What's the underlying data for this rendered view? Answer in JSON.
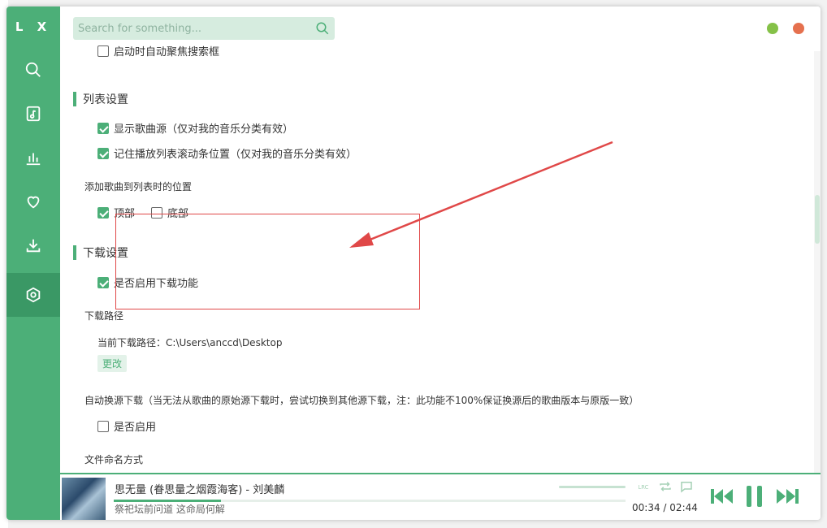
{
  "app": {
    "logo": "L X"
  },
  "search": {
    "placeholder": "Search for something..."
  },
  "window_buttons": {
    "min_color": "#85c148",
    "close_color": "#e5704e"
  },
  "settings": {
    "partial_item": "启动时自动聚焦搜索框",
    "list_section": {
      "title": "列表设置",
      "show_source": "显示歌曲源（仅对我的音乐分类有效）",
      "remember_scroll": "记住播放列表滚动条位置（仅对我的音乐分类有效）",
      "add_position_label": "添加歌曲到列表时的位置",
      "top": "顶部",
      "bottom": "底部"
    },
    "download_section": {
      "title": "下载设置",
      "enable": "是否启用下载功能",
      "path_label": "下载路径",
      "current_path_prefix": "当前下载路径：",
      "current_path": "C:\\Users\\anccd\\Desktop",
      "change_button": "更改",
      "auto_switch_label": "自动换源下载（当无法从歌曲的原始源下载时，尝试切换到其他源下载，注：此功能不100%保证换源后的歌曲版本与原版一致）",
      "auto_switch_enable": "是否启用",
      "file_naming_label": "文件命名方式"
    }
  },
  "player": {
    "title": "思无量 (眷思量之烟霞海客) - 刘美麟",
    "lyric": "祭祀坛前问道 这命局何解",
    "current_time": "00:34",
    "separator": "/",
    "total_time": "02:44",
    "progress": 0.21
  },
  "accent": "#4caf78"
}
